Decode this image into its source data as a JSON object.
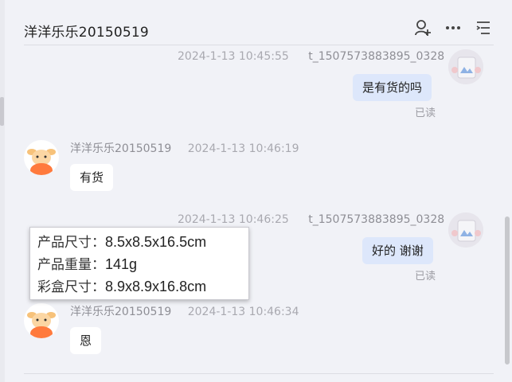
{
  "header": {
    "title": "洋洋乐乐20150519",
    "icons": [
      "add-person-icon",
      "more-icon",
      "list-icon"
    ]
  },
  "messages": [
    {
      "direction": "out",
      "time": "2024-1-13 10:45:55",
      "sender": "t_1507573883895_0328",
      "text": "是有货的吗",
      "status": "已读"
    },
    {
      "direction": "in",
      "sender": "洋洋乐乐20150519",
      "time": "2024-1-13 10:46:19",
      "text": "有货"
    },
    {
      "direction": "out",
      "time": "2024-1-13 10:46:25",
      "sender": "t_1507573883895_0328",
      "text": "好的 谢谢",
      "status": "已读"
    },
    {
      "direction": "in",
      "sender": "洋洋乐乐20150519",
      "time": "2024-1-13 10:46:34",
      "text": "恩"
    }
  ],
  "tooltip": {
    "lines": [
      {
        "label": "产品尺寸：",
        "value": "8.5x8.5x16.5cm"
      },
      {
        "label": "产品重量：",
        "value": "141g"
      },
      {
        "label": "彩盒尺寸：",
        "value": "8.9x8.9x16.8cm"
      }
    ]
  }
}
